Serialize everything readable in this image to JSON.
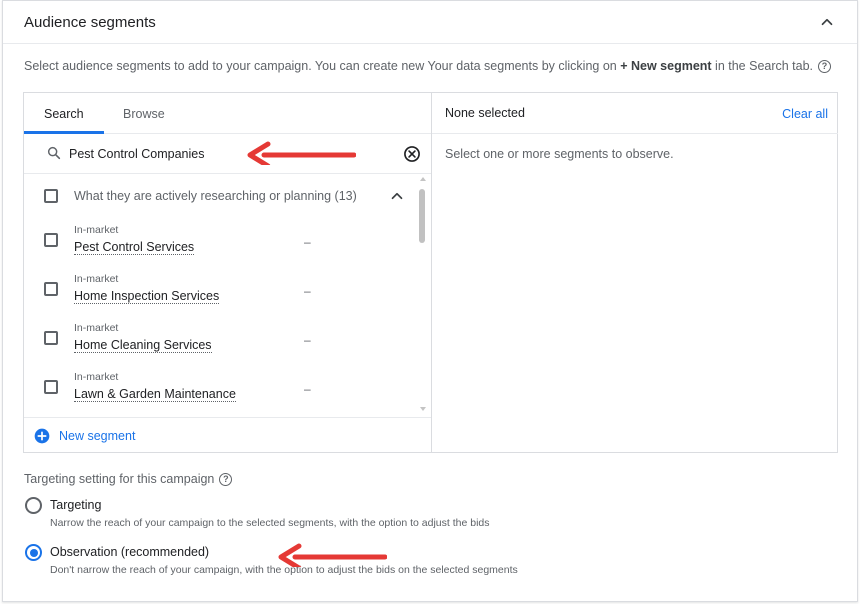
{
  "header": {
    "title": "Audience segments",
    "collapse_icon": "chevron-up-icon"
  },
  "description": {
    "text_before": "Select audience segments to add to your campaign. You can create new Your data segments by clicking on ",
    "bold_text": "+ New segment",
    "text_after": " in the Search tab.",
    "help_icon": "?"
  },
  "search_panel": {
    "tabs": [
      {
        "label": "Search",
        "active": true
      },
      {
        "label": "Browse",
        "active": false
      }
    ],
    "search": {
      "value": "Pest Control Companies",
      "placeholder": "Search"
    },
    "group": {
      "label": "What they are actively researching or planning (13)",
      "expanded": true
    },
    "items": [
      {
        "category": "In-market",
        "name": "Pest Control Services",
        "value": "–",
        "checked": false
      },
      {
        "category": "In-market",
        "name": "Home Inspection Services",
        "value": "–",
        "checked": false
      },
      {
        "category": "In-market",
        "name": "Home Cleaning Services",
        "value": "–",
        "checked": false
      },
      {
        "category": "In-market",
        "name": "Lawn & Garden Maintenance",
        "value": "–",
        "checked": false
      }
    ],
    "new_segment_label": "New segment"
  },
  "selected_panel": {
    "title": "None selected",
    "clear_all_label": "Clear all",
    "hint": "Select one or more segments to observe."
  },
  "targeting": {
    "title": "Targeting setting for this campaign",
    "help_icon": "?",
    "options": [
      {
        "label": "Targeting",
        "description": "Narrow the reach of your campaign to the selected segments, with the option to adjust the bids",
        "selected": false
      },
      {
        "label": "Observation (recommended)",
        "description": "Don't narrow the reach of your campaign, with the option to adjust the bids on the selected segments",
        "selected": true
      }
    ]
  },
  "colors": {
    "accent": "#1a73e8",
    "annotation_arrow": "#e53935"
  }
}
